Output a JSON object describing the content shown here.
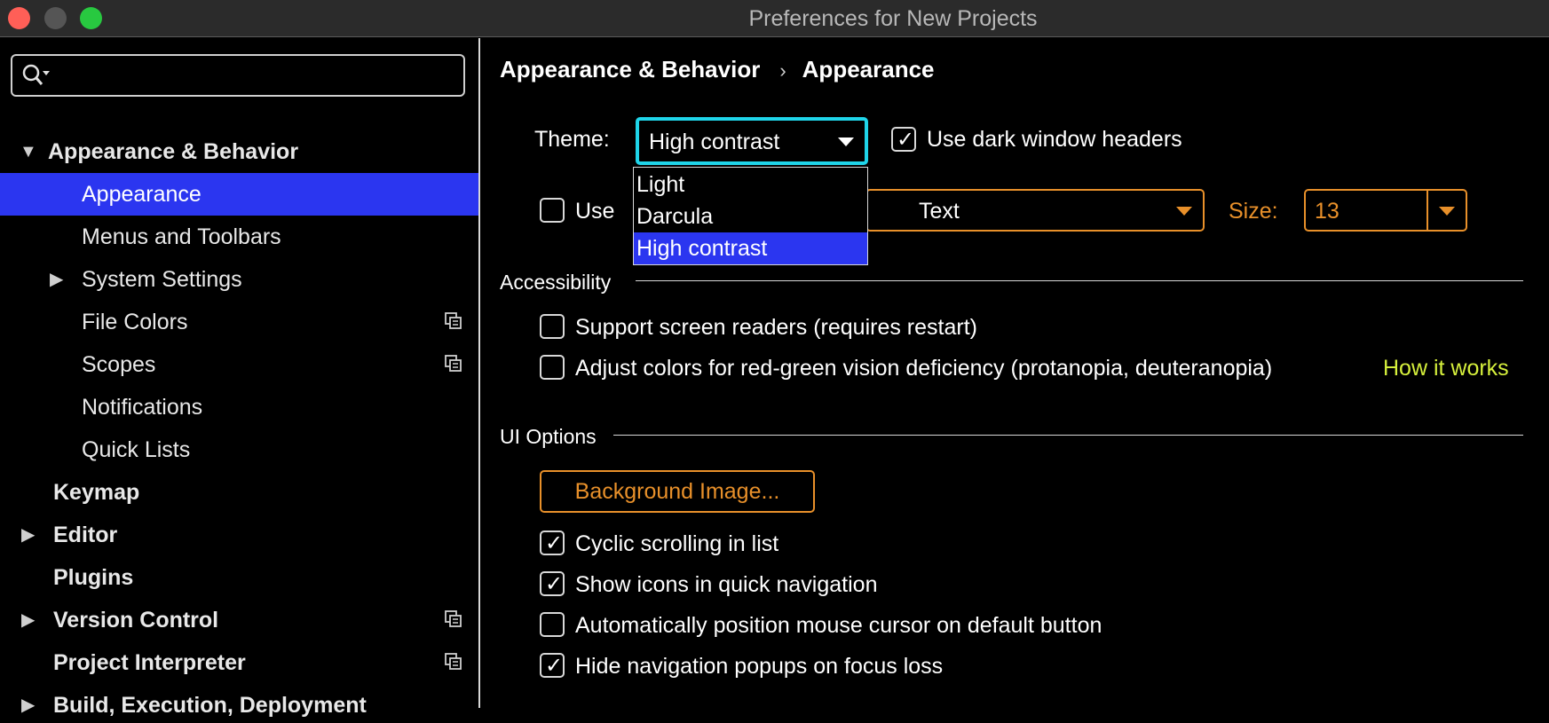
{
  "window": {
    "title": "Preferences for New Projects"
  },
  "search": {
    "value": "",
    "placeholder": ""
  },
  "sidebar": {
    "items": [
      {
        "label": "Appearance & Behavior",
        "arrow": "▼"
      },
      {
        "label": "Appearance"
      },
      {
        "label": "Menus and Toolbars"
      },
      {
        "label": "System Settings",
        "arrow": "▶"
      },
      {
        "label": "File Colors"
      },
      {
        "label": "Scopes"
      },
      {
        "label": "Notifications"
      },
      {
        "label": "Quick Lists"
      },
      {
        "label": "Keymap"
      },
      {
        "label": "Editor",
        "arrow": "▶"
      },
      {
        "label": "Plugins"
      },
      {
        "label": "Version Control",
        "arrow": "▶"
      },
      {
        "label": "Project Interpreter"
      },
      {
        "label": "Build, Execution, Deployment",
        "arrow": "▶"
      }
    ]
  },
  "breadcrumb": {
    "parent": "Appearance & Behavior",
    "separator": "›",
    "current": "Appearance"
  },
  "theme": {
    "label": "Theme:",
    "value": "High contrast",
    "options": [
      "Light",
      "Darcula",
      "High contrast"
    ],
    "selected_option": "High contrast"
  },
  "dark_headers": {
    "label": "Use dark window headers",
    "checked": true,
    "tick": "✓"
  },
  "custom_font": {
    "label": "Use",
    "checked": false,
    "font_value": "Text",
    "size_label": "Size:",
    "size_value": "13"
  },
  "accessibility": {
    "title": "Accessibility",
    "screen_readers": {
      "label": "Support screen readers (requires restart)",
      "checked": false
    },
    "color_adjust": {
      "label": "Adjust colors for red-green vision deficiency (protanopia, deuteranopia)",
      "checked": false
    },
    "how_link": "How it works"
  },
  "ui_options": {
    "title": "UI Options",
    "background_button": "Background Image...",
    "cyclic": {
      "label": "Cyclic scrolling in list",
      "checked": true,
      "tick": "✓"
    },
    "show_icons": {
      "label": "Show icons in quick navigation",
      "checked": true,
      "tick": "✓"
    },
    "auto_position": {
      "label": "Automatically position mouse cursor on default button",
      "checked": false
    },
    "hide_popups": {
      "label": "Hide navigation popups on focus loss",
      "checked": true,
      "tick": "✓"
    }
  },
  "colors": {
    "accent_selection": "#2b36f0",
    "focus_ring": "#1fd5ea",
    "modified_orange": "#e8902a",
    "link_green": "#d6f03c"
  }
}
